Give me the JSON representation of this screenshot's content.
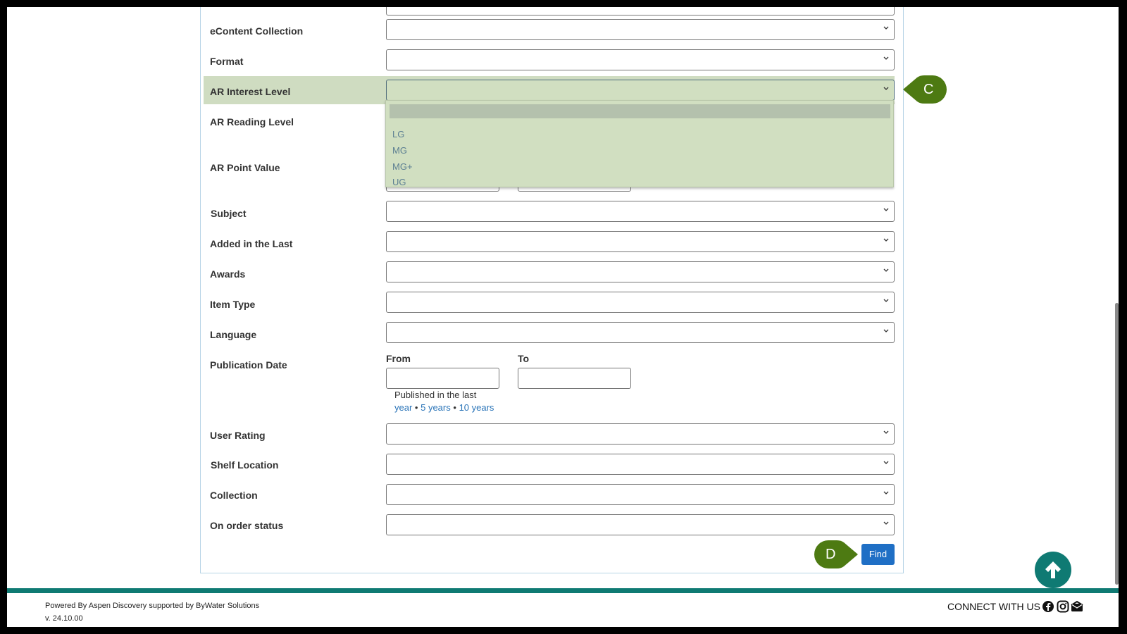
{
  "form": {
    "rows": [
      {
        "label": "eContent Collection"
      },
      {
        "label": "Format"
      },
      {
        "label": "AR Interest Level"
      },
      {
        "label": "AR Reading Level"
      },
      {
        "label": "AR Point Value"
      },
      {
        "label": "Subject"
      },
      {
        "label": "Added in the Last"
      },
      {
        "label": "Awards"
      },
      {
        "label": "Item Type"
      },
      {
        "label": "Language"
      },
      {
        "label": "Publication Date"
      },
      {
        "label": "User Rating"
      },
      {
        "label": "Shelf Location"
      },
      {
        "label": "Collection"
      },
      {
        "label": "On order status"
      }
    ],
    "publication_date": {
      "from_label": "From",
      "to_label": "To",
      "from_value": "",
      "to_value": "",
      "published_in_the_last": "Published in the last",
      "links": [
        "year",
        "5 years",
        "10 years"
      ],
      "separator": "•"
    },
    "ar_interest_level_options": [
      "",
      "LG",
      "MG",
      "MG+",
      "UG"
    ],
    "find_label": "Find"
  },
  "callouts": {
    "c": "C",
    "d": "D"
  },
  "footer": {
    "powered_by": "Powered By Aspen Discovery supported by ByWater Solutions",
    "version": "v. 24.10.00",
    "connect": "CONNECT WITH US",
    "social_icons": [
      "facebook-icon",
      "instagram-icon",
      "email-icon"
    ]
  },
  "colors": {
    "accent_green": "#4d7a12",
    "highlight": "#cfdcc1",
    "button_blue": "#1f6fc5",
    "teal": "#0f7a73"
  }
}
